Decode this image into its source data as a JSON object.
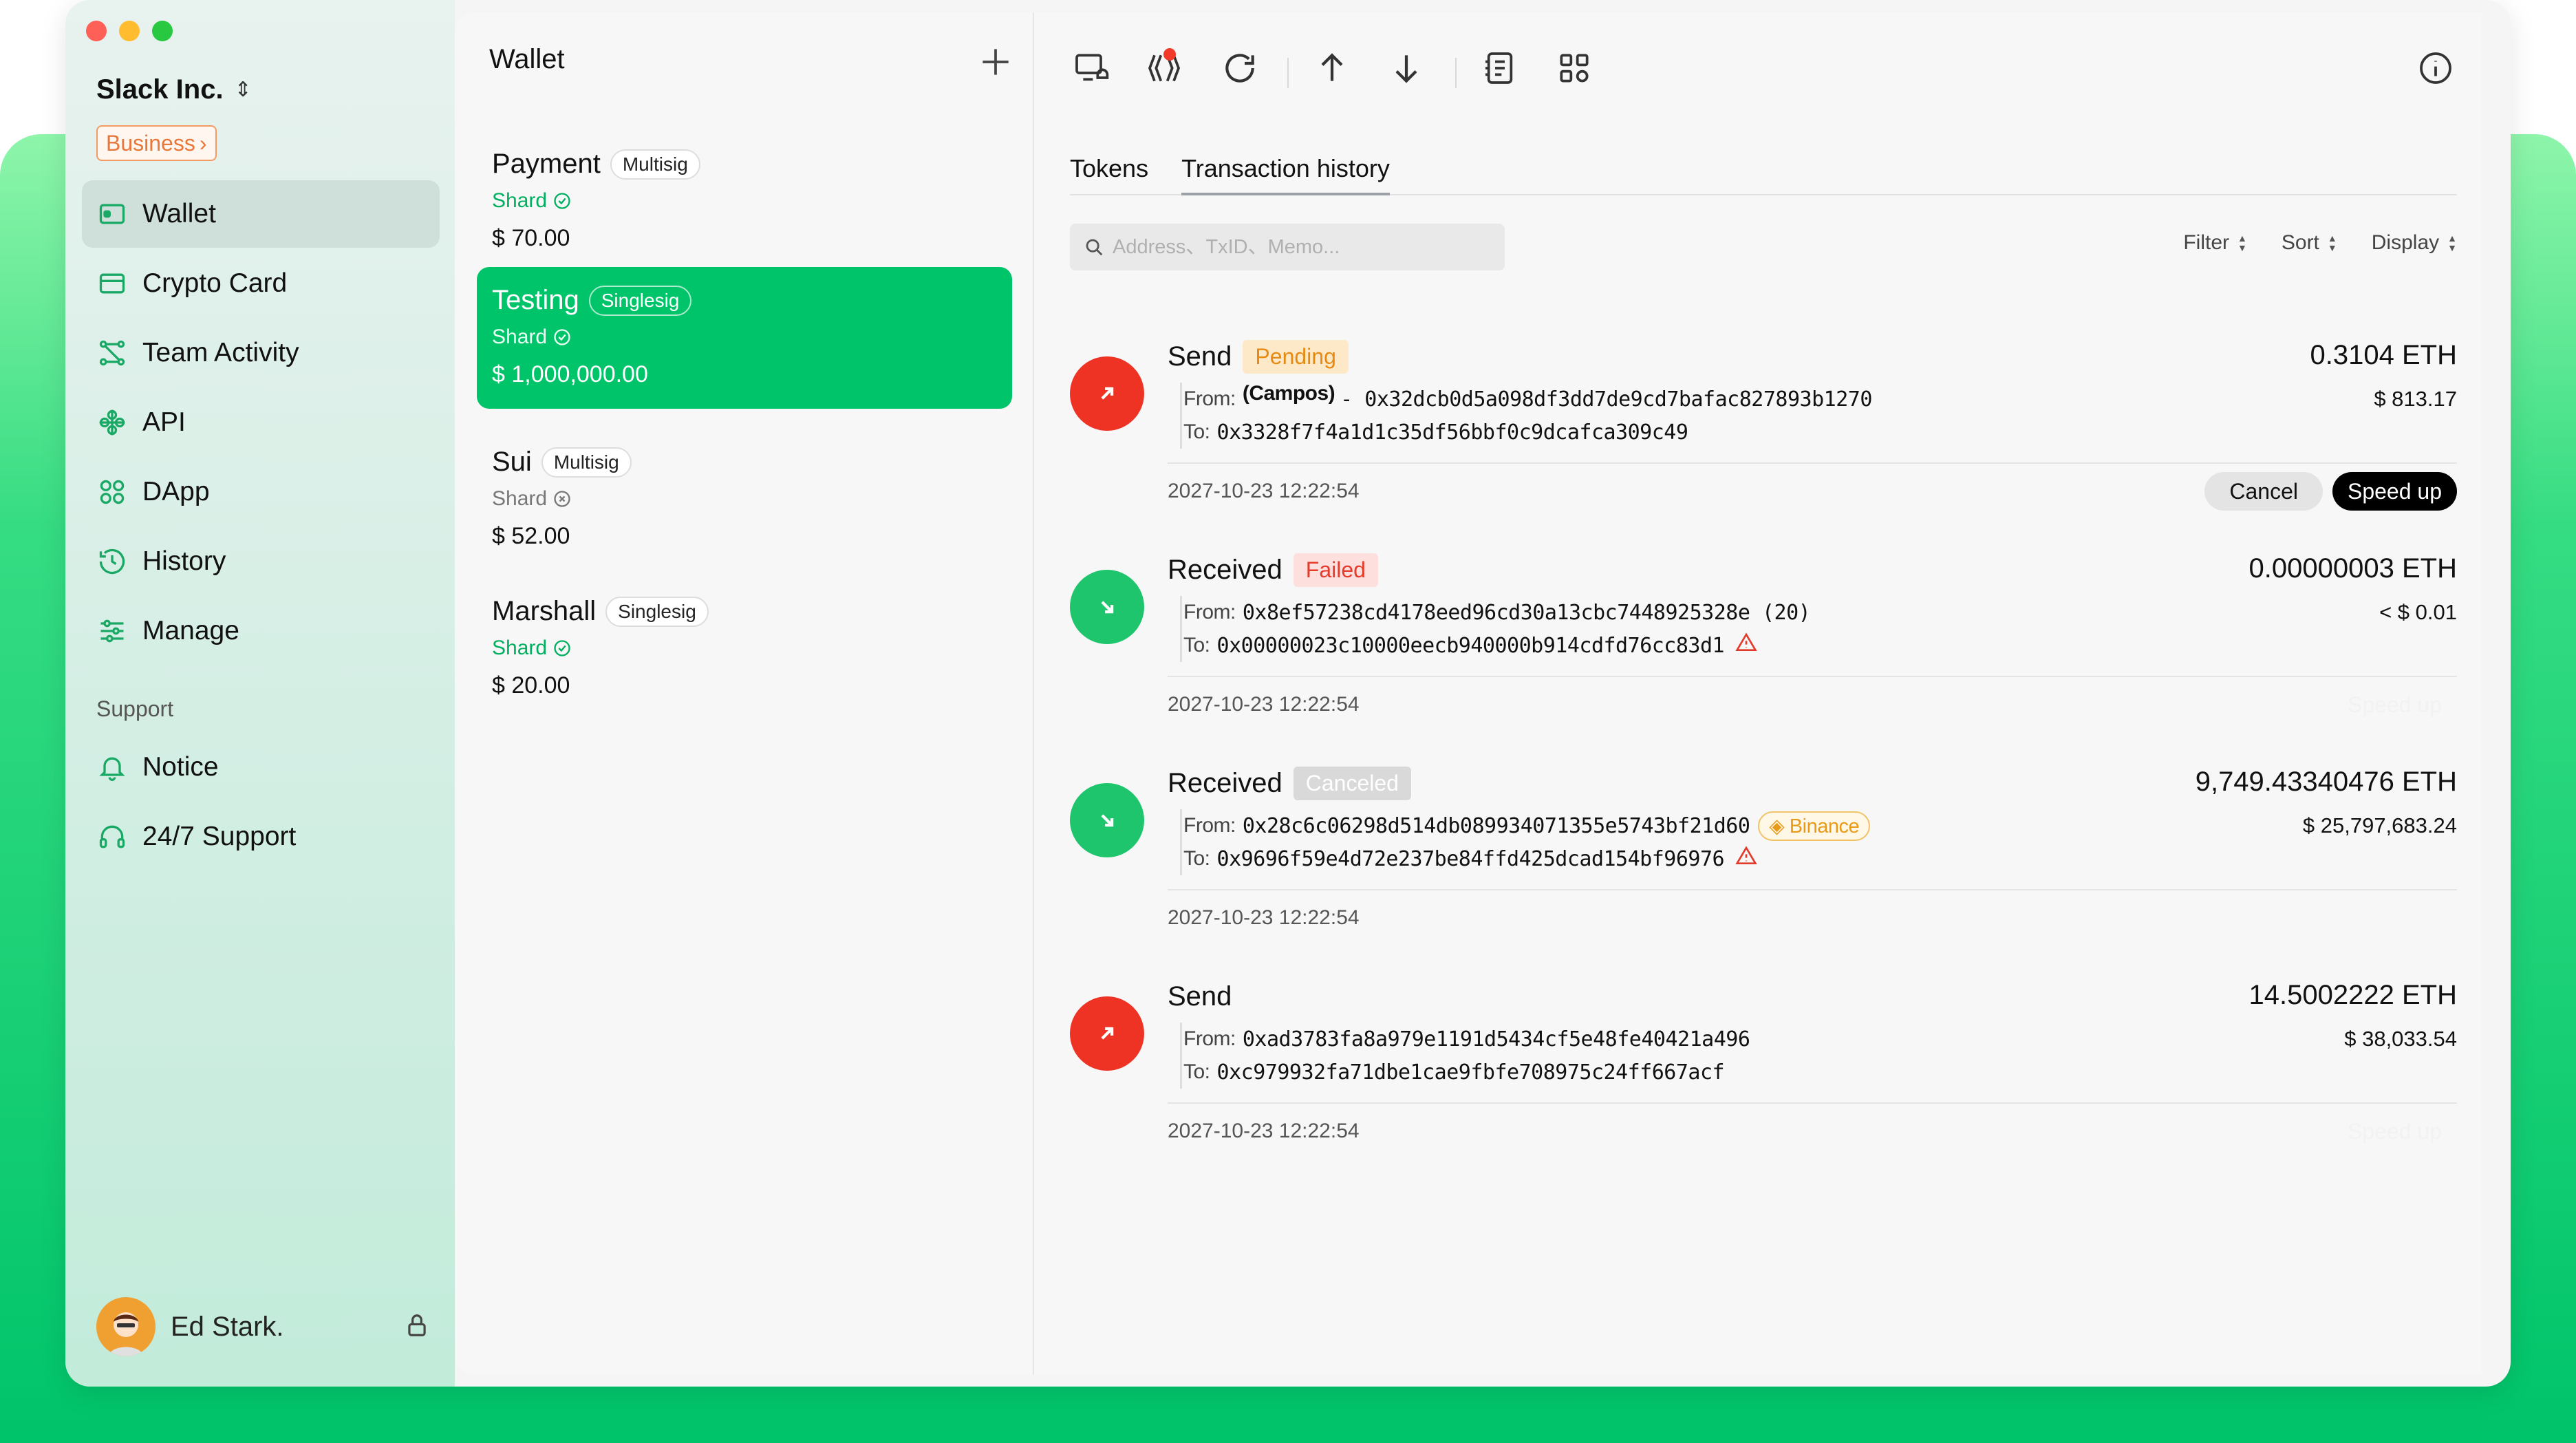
{
  "app": {
    "org_name": "Slack Inc.",
    "plan_badge": "Business",
    "nav": [
      {
        "label": "Wallet",
        "icon": "wallet-icon",
        "active": true
      },
      {
        "label": "Crypto Card",
        "icon": "card-icon"
      },
      {
        "label": "Team Activity",
        "icon": "team-activity-icon"
      },
      {
        "label": "API",
        "icon": "api-icon"
      },
      {
        "label": "DApp",
        "icon": "dapp-icon"
      },
      {
        "label": "History",
        "icon": "history-icon"
      },
      {
        "label": "Manage",
        "icon": "manage-icon"
      }
    ],
    "support_title": "Support",
    "support_nav": [
      {
        "label": "Notice",
        "icon": "bell-icon"
      },
      {
        "label": "24/7 Support",
        "icon": "headset-icon"
      }
    ],
    "user_name": "Ed Stark."
  },
  "wallets": {
    "title": "Wallet",
    "items": [
      {
        "name": "Payment",
        "type": "Multisig",
        "shard": "Shard",
        "amount": "$ 70.00"
      },
      {
        "name": "Testing",
        "type": "Singlesig",
        "shard": "Shard",
        "amount": "$ 1,000,000.00"
      },
      {
        "name": "Sui",
        "type": "Multisig",
        "shard": "Shard",
        "amount": "$ 52.00"
      },
      {
        "name": "Marshall",
        "type": "Singlesig",
        "shard": "Shard",
        "amount": "$ 20.00"
      }
    ]
  },
  "main": {
    "tabs": [
      "Tokens",
      "Transaction history"
    ],
    "search_placeholder": "Address、TxID、Memo...",
    "filters": [
      "Filter",
      "Sort",
      "Display"
    ],
    "transactions": [
      {
        "type": "Send",
        "status": "Pending",
        "amount": "0.3104 ETH",
        "usd": "$ 813.17",
        "from_key": "From:",
        "from_alias": "(Campos)",
        "from": "- 0x32dcb0d5a098df3dd7de9cd7bafac827893b1270",
        "to_key": "To:",
        "to": "0x3328f7f4a1d1c35df56bbf0c9dcafca309c49",
        "time": "2027-10-23  12:22:54",
        "cancel": "Cancel",
        "speed": "Speed up"
      },
      {
        "type": "Received",
        "status": "Failed",
        "amount": "0.00000003 ETH",
        "usd": "< $ 0.01",
        "from_key": "From:",
        "from": "0x8ef57238cd4178eed96cd30a13cbc7448925328e (20)",
        "to_key": "To:",
        "to": "0x00000023c10000eecb940000b914cdfd76cc83d1",
        "time": "2027-10-23  12:22:54",
        "speed": "Speed up"
      },
      {
        "type": "Received",
        "status": "Canceled",
        "amount": "9,749.43340476 ETH",
        "usd": "$ 25,797,683.24",
        "from_key": "From:",
        "from": "0x28c6c06298d514db089934071355e5743bf21d60",
        "exchange": "Binance",
        "to_key": "To:",
        "to": "0x9696f59e4d72e237be84ffd425dcad154bf96976",
        "time": "2027-10-23  12:22:54"
      },
      {
        "type": "Send",
        "amount": "14.5002222 ETH",
        "usd": "$ 38,033.54",
        "from_key": "From:",
        "from": "0xad3783fa8a979e1191d5434cf5e48fe40421a496",
        "to_key": "To:",
        "to": "0xc979932fa71dbe1cae9fbfe708975c24ff667acf",
        "time": "2027-10-23  12:22:54",
        "speed": "Speed up"
      }
    ]
  },
  "colors": {
    "accent": "#00c46a",
    "send": "#ee3324",
    "received": "#1fc56c"
  }
}
